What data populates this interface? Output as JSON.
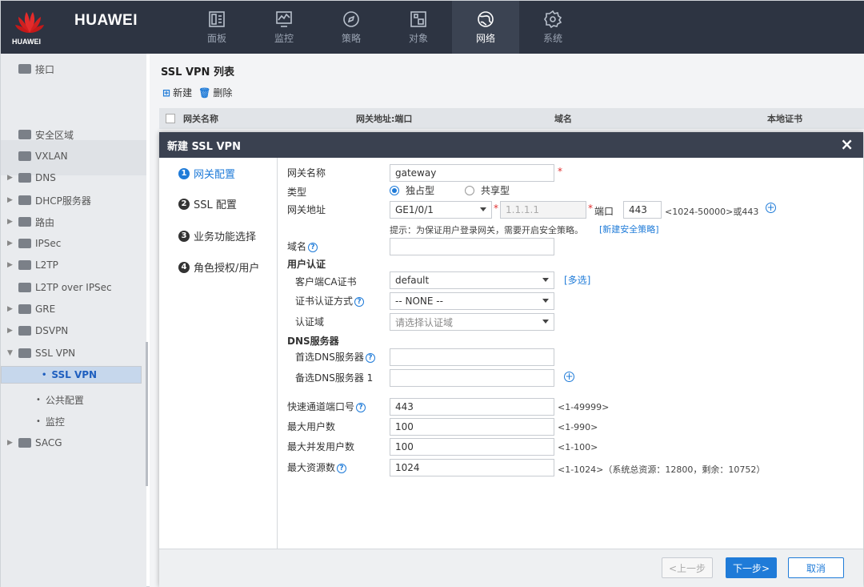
{
  "brand": {
    "name": "HUAWEI",
    "sub": "HUAWEI"
  },
  "topnav": [
    {
      "label": "面板",
      "icon": "dashboard-icon"
    },
    {
      "label": "监控",
      "icon": "monitor-icon"
    },
    {
      "label": "策略",
      "icon": "compass-icon"
    },
    {
      "label": "对象",
      "icon": "object-icon"
    },
    {
      "label": "网络",
      "icon": "globe-icon",
      "active": true
    },
    {
      "label": "系统",
      "icon": "gear-icon"
    }
  ],
  "sidebar": {
    "items": [
      {
        "label": "接口"
      },
      {
        "label": "安全区域"
      },
      {
        "label": "VXLAN"
      },
      {
        "label": "DNS"
      },
      {
        "label": "DHCP服务器"
      },
      {
        "label": "路由"
      },
      {
        "label": "IPSec"
      },
      {
        "label": "L2TP"
      },
      {
        "label": "L2TP over IPSec"
      },
      {
        "label": "GRE"
      },
      {
        "label": "DSVPN"
      },
      {
        "label": "SSL VPN"
      },
      {
        "label": "SSL VPN"
      },
      {
        "label": "公共配置"
      },
      {
        "label": "监控"
      },
      {
        "label": "SACG"
      }
    ]
  },
  "main": {
    "title": "SSL VPN 列表",
    "new_label": "新建",
    "delete_label": "删除",
    "columns": [
      "网关名称",
      "网关地址:端口",
      "域名",
      "本地证书"
    ]
  },
  "dialog": {
    "title": "新建 SSL VPN",
    "close": "×",
    "steps": [
      {
        "num": "1",
        "label": "网关配置"
      },
      {
        "num": "2",
        "label": "SSL 配置"
      },
      {
        "num": "3",
        "label": "业务功能选择"
      },
      {
        "num": "4",
        "label": "角色授权/用户"
      }
    ],
    "form": {
      "gw_name_label": "网关名称",
      "gw_name_value": "gateway",
      "type_label": "类型",
      "type_exclusive": "独占型",
      "type_shared": "共享型",
      "gw_addr_label": "网关地址",
      "gw_iface": "GE1/0/1",
      "gw_ip": "1.1.1.1",
      "port_label": "端口",
      "port_value": "443",
      "port_hint": "<1024-50000>或443",
      "tip": "提示：为保证用户登录网关，需要开启安全策略。",
      "tip_link": "[新建安全策略]",
      "domain_label": "域名",
      "user_auth_label": "用户认证",
      "client_ca_label": "客户端CA证书",
      "client_ca_value": "default",
      "multi_select": "[多选]",
      "cert_auth_label": "证书认证方式",
      "cert_auth_value": "-- NONE --",
      "auth_domain_label": "认证域",
      "auth_domain_value": "请选择认证域",
      "dns_label": "DNS服务器",
      "dns1_label": "首选DNS服务器",
      "dns2_label": "备选DNS服务器 1",
      "fast_port_label": "快速通道端口号",
      "fast_port_value": "443",
      "fast_port_hint": "<1-49999>",
      "max_users_label": "最大用户数",
      "max_users_value": "100",
      "max_users_hint": "<1-990>",
      "max_conc_label": "最大并发用户数",
      "max_conc_value": "100",
      "max_conc_hint": "<1-100>",
      "max_res_label": "最大资源数",
      "max_res_value": "1024",
      "max_res_hint": "<1-1024>（系统总资源：12800，剩余：10752）"
    },
    "buttons": {
      "prev": "<上一步",
      "next": "下一步>",
      "cancel": "取消"
    }
  }
}
